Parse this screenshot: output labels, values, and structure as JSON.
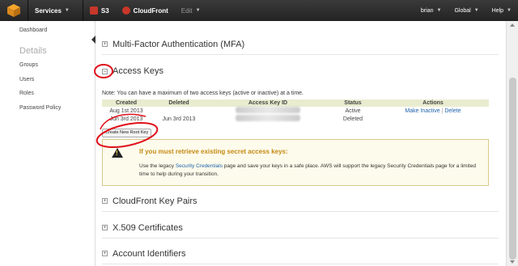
{
  "topbar": {
    "services": "Services",
    "s3": "S3",
    "cloudfront": "CloudFront",
    "edit": "Edit",
    "user": "brian",
    "region": "Global",
    "help": "Help"
  },
  "sidebar": {
    "dashboard": "Dashboard",
    "details": "Details",
    "items": [
      "Groups",
      "Users",
      "Roles",
      "Password Policy"
    ]
  },
  "sections": {
    "mfa": "Multi-Factor Authentication (MFA)",
    "access_keys": "Access Keys",
    "cloudfront_keys": "CloudFront Key Pairs",
    "x509": "X.509 Certificates",
    "account_ids": "Account Identifiers"
  },
  "access_keys": {
    "note": "Note: You can have a maximum of two access keys (active or inactive) at a time.",
    "headers": [
      "Created",
      "Deleted",
      "Access Key ID",
      "Status",
      "Actions"
    ],
    "rows": [
      {
        "created": "Aug 1st 2013",
        "deleted": "",
        "status": "Active",
        "make_inactive": "Make Inactive",
        "delete": "Delete"
      },
      {
        "created": "Jun 3rd 2013",
        "deleted": "Jun 3rd 2013",
        "status": "Deleted"
      }
    ],
    "action_sep": "|",
    "create_button": "Create New Root Key"
  },
  "warning": {
    "title": "If you must retrieve existing secret access keys:",
    "body_pre": "Use the legacy ",
    "link": "Security Credentials",
    "body_post": " page and save your keys in a safe place. AWS will support the legacy Security Credentials page for a limited time to help during your transition."
  },
  "colors": {
    "topbar": "#2b2b2b",
    "link": "#1d62ab",
    "warning_title": "#c58a13",
    "warning_bg": "#fdfbec",
    "annotation": "#e0101a"
  }
}
